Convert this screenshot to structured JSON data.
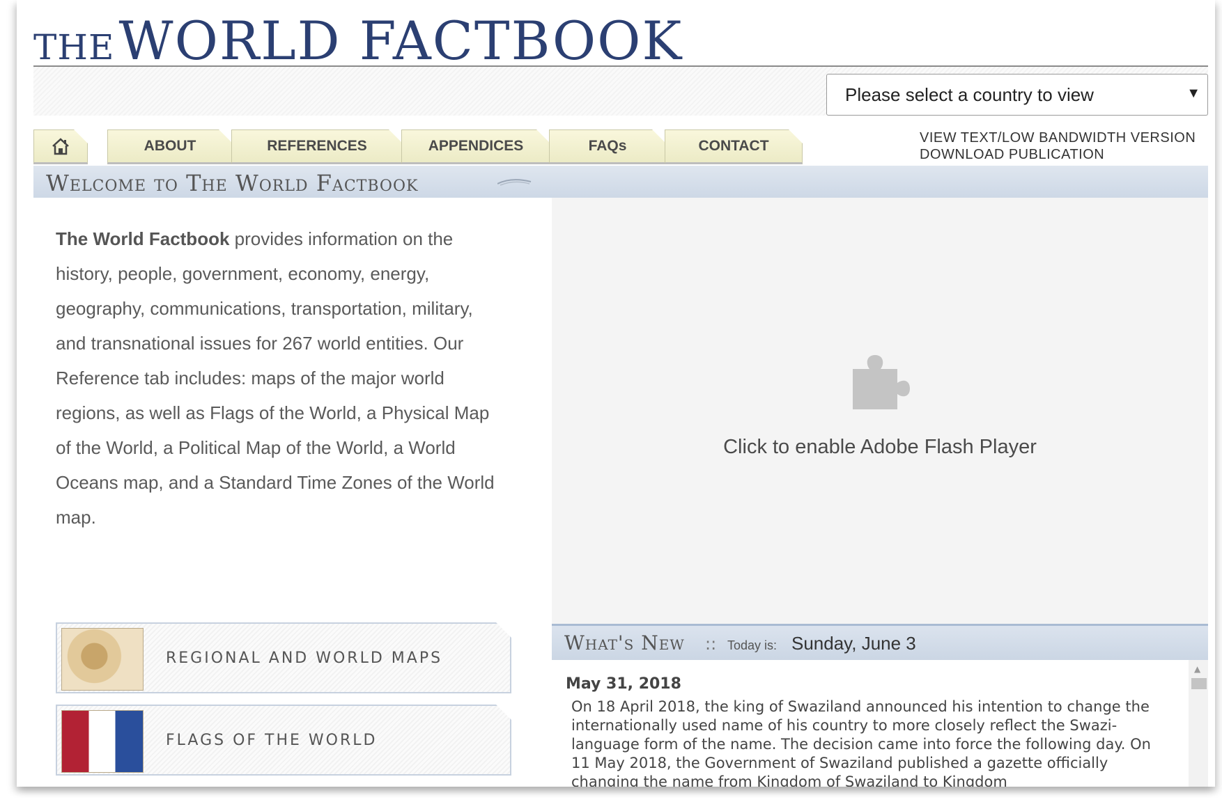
{
  "masthead": {
    "logo_the": "THE",
    "logo_main": "WORLD FACTBOOK"
  },
  "country_select": {
    "value": "Please select a country to view",
    "arrow": "▼"
  },
  "nav": {
    "home_icon": "home-icon",
    "tabs": [
      {
        "label": "ABOUT"
      },
      {
        "label": "REFERENCES"
      },
      {
        "label": "APPENDICES"
      },
      {
        "label": "FAQs"
      },
      {
        "label": "CONTACT"
      }
    ]
  },
  "utility_links": {
    "text_version": "VIEW TEXT/LOW BANDWIDTH VERSION",
    "download": "DOWNLOAD PUBLICATION"
  },
  "welcome": {
    "title": "Welcome to The World Factbook"
  },
  "intro": {
    "bold": "The World Factbook",
    "text": " provides information on the history, people, government, economy, energy, geography, communications, transportation, military, and transnational issues for 267 world entities. Our Reference tab includes: maps of the major world regions, as well as Flags of the World, a Physical Map of the World, a Political Map of the World, a World Oceans map, and a Standard Time Zones of the World map."
  },
  "banners": {
    "maps": "REGIONAL AND WORLD MAPS",
    "flags": "FLAGS OF THE WORLD"
  },
  "flash": {
    "icon": "puzzle-piece-icon",
    "text": "Click to enable Adobe Flash Player"
  },
  "whats_new": {
    "title": "What's New",
    "separator": "::",
    "today_label": "Today is:",
    "today_value": "Sunday, June 3",
    "items": [
      {
        "date": "May 31, 2018",
        "body": "On 18 April 2018, the king of Swaziland announced his intention to change the internationally used name of his country to more closely reflect the Swazi-language form of the name. The decision came into force the following day. On 11 May 2018, the Government of Swaziland published a gazette officially changing the name from Kingdom of Swaziland to Kingdom"
      }
    ]
  },
  "colors": {
    "logo": "#2b3f72",
    "tab_bg": "#f3f1d2",
    "band_bg": "#d5deea"
  }
}
